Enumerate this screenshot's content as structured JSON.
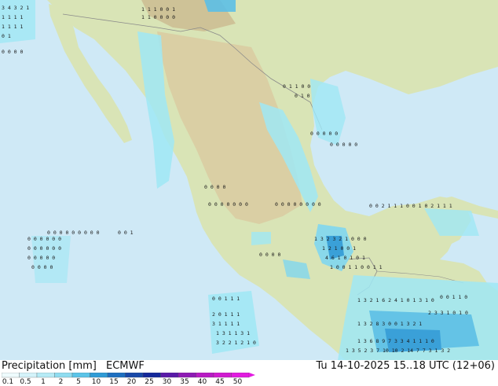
{
  "map": {
    "land_color": "#d9e4b6",
    "highland_color": "#d9c9a0",
    "water_color": "#cfe9f6",
    "precip_colors": [
      "#9fe7f5",
      "#7fd6ef",
      "#5cbfe6",
      "#3aa0d8"
    ]
  },
  "footer": {
    "title": "Precipitation [mm]",
    "model": "ECMWF",
    "run": "Tu 14-10-2025 15..18 UTC (12+06)"
  },
  "legend": {
    "labels": [
      "0.1",
      "0.5",
      "1",
      "2",
      "5",
      "10",
      "15",
      "20",
      "25",
      "30",
      "35",
      "40",
      "45",
      "50"
    ],
    "colors": [
      "#eefbfd",
      "#d4f3fa",
      "#b6ebf6",
      "#8fdcf0",
      "#5bc4e8",
      "#2f9bd6",
      "#1d6fc0",
      "#1848a8",
      "#14289a",
      "#5a1aa8",
      "#8e1ab4",
      "#b81ac4",
      "#d01ad0",
      "#e21ae0"
    ]
  },
  "grid_values": [
    {
      "t": "3 4 3 2 1"
    },
    {
      "t": "1 1 1 1"
    },
    {
      "t": "1 1 1 1"
    },
    {
      "t": "0 1"
    },
    {
      "t": "0 0 0 0"
    },
    {
      "t": "1 1 0 0 0 0"
    },
    {
      "t": "1 1 1 0 0 1"
    },
    {
      "t": "0 1 1 0 0"
    },
    {
      "t": "0 1 0"
    },
    {
      "t": "0 0 0 0 0 0"
    },
    {
      "t": "0 0 0 0 0 0"
    },
    {
      "t": "0 0 0 0 0"
    },
    {
      "t": "0 0 0 0"
    },
    {
      "t": "0 0 0 0 0 0 0 0 0"
    },
    {
      "t": "0 0 0 0 0 0 0 0"
    },
    {
      "t": "0 0 0 0 0 0 0"
    },
    {
      "t": "0 0 2 1 1 1 0 0 1 0 2 1 1 1"
    },
    {
      "t": "1 3 2 3 2 1 0 0 0"
    },
    {
      "t": "1 2 1 0 0 1"
    },
    {
      "t": "4 6 1 0 1 0 1"
    },
    {
      "t": "1 0 0 1 1 0 0 1 1"
    },
    {
      "t": "1 3 2 1 6 2 4 1 0 1 3 1 0"
    },
    {
      "t": "1 3 2 8 3 0 0 1 3 2 1"
    },
    {
      "t": "1 3 6 8 9 7 3 3 4 1 1 1 0"
    },
    {
      "t": "1 3 5 2 3 7 10 10 2 14 7 7 3 1 3 2"
    },
    {
      "t": "0 0 1 1 1"
    },
    {
      "t": "2 0 1 1 1"
    },
    {
      "t": "3 1 1 1 1"
    },
    {
      "t": "1 3 1 1 3 1"
    },
    {
      "t": "3 2 2 1 2 1 0"
    },
    {
      "t": "2 3 3 1 0 1 0"
    },
    {
      "t": "0 0 1"
    },
    {
      "t": "0 0 0 0 0"
    },
    {
      "t": "0 0 0 0 0"
    },
    {
      "t": "0 0 0 0"
    },
    {
      "t": "0 0 0 0"
    },
    {
      "t": "0 0 1 1 0"
    }
  ]
}
